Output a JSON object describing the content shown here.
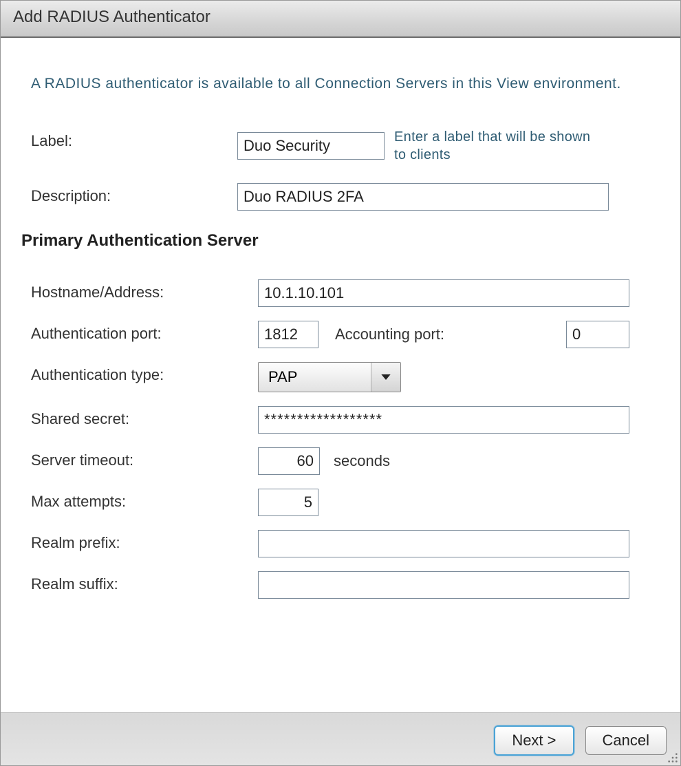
{
  "dialog": {
    "title": "Add RADIUS Authenticator",
    "intro": "A RADIUS authenticator is available to all Connection Servers in this View environment."
  },
  "fields": {
    "label_label": "Label:",
    "label_value": "Duo Security",
    "label_hint": "Enter a label that will be shown to clients",
    "description_label": "Description:",
    "description_value": "Duo RADIUS 2FA"
  },
  "section_heading": "Primary Authentication Server",
  "server": {
    "hostname_label": "Hostname/Address:",
    "hostname_value": "10.1.10.101",
    "auth_port_label": "Authentication port:",
    "auth_port_value": "1812",
    "acct_port_label": "Accounting port:",
    "acct_port_value": "0",
    "auth_type_label": "Authentication type:",
    "auth_type_value": "PAP",
    "shared_secret_label": "Shared secret:",
    "shared_secret_value": "******************",
    "server_timeout_label": "Server timeout:",
    "server_timeout_value": "60",
    "server_timeout_unit": "seconds",
    "max_attempts_label": "Max attempts:",
    "max_attempts_value": "5",
    "realm_prefix_label": "Realm prefix:",
    "realm_prefix_value": "",
    "realm_suffix_label": "Realm suffix:",
    "realm_suffix_value": ""
  },
  "buttons": {
    "next": "Next >",
    "cancel": "Cancel"
  }
}
